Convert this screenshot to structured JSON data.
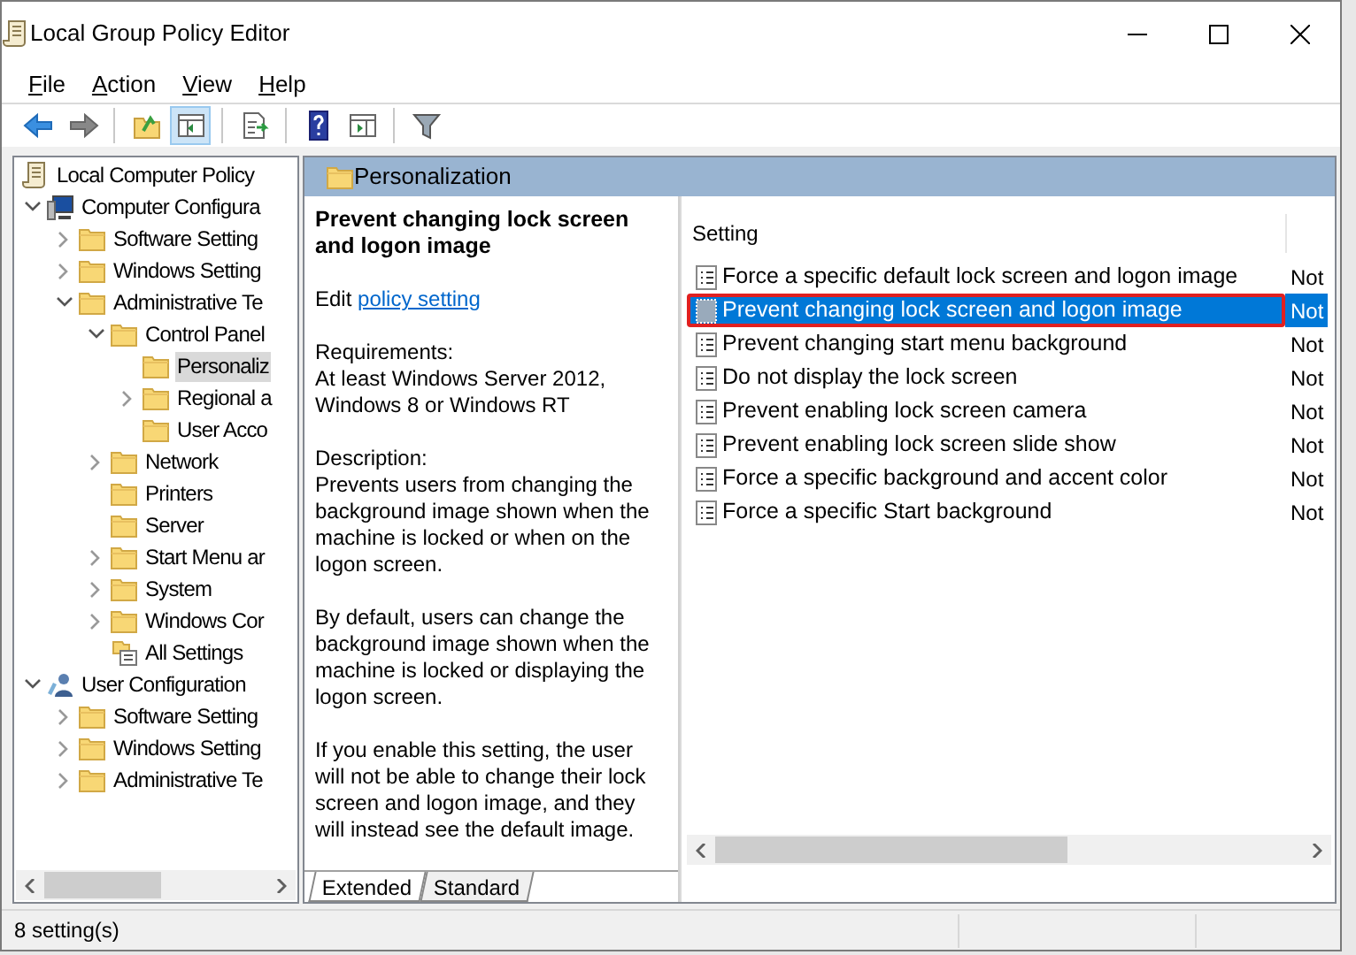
{
  "window": {
    "title": "Local Group Policy Editor"
  },
  "menu": [
    "File",
    "Action",
    "View",
    "Help"
  ],
  "toolbar": [
    {
      "kind": "back",
      "pressed": false
    },
    {
      "kind": "forward",
      "pressed": false
    },
    {
      "kind": "sep"
    },
    {
      "kind": "up",
      "pressed": false
    },
    {
      "kind": "tree-pane",
      "pressed": true
    },
    {
      "kind": "sep"
    },
    {
      "kind": "export",
      "pressed": false
    },
    {
      "kind": "sep"
    },
    {
      "kind": "help",
      "pressed": false
    },
    {
      "kind": "action-pane",
      "pressed": false
    },
    {
      "kind": "sep"
    },
    {
      "kind": "filter",
      "pressed": false
    }
  ],
  "tree": {
    "label": "Local Computer Policy",
    "kind": "policy",
    "children": [
      {
        "label": "Computer Configura",
        "kind": "computer",
        "expanded": true,
        "selected": false,
        "children": [
          {
            "label": "Software Setting",
            "kind": "folder",
            "expanded": false,
            "selected": false
          },
          {
            "label": "Windows Setting",
            "kind": "folder",
            "expanded": false,
            "selected": false
          },
          {
            "label": "Administrative Te",
            "kind": "folder",
            "expanded": true,
            "selected": false,
            "children": [
              {
                "label": "Control Panel",
                "kind": "folder",
                "expanded": true,
                "selected": false,
                "children": [
                  {
                    "label": "Personaliz",
                    "kind": "folder",
                    "selected": true
                  },
                  {
                    "label": "Regional a",
                    "kind": "folder",
                    "expanded": false,
                    "selected": false
                  },
                  {
                    "label": "User Acco",
                    "kind": "folder",
                    "selected": false
                  }
                ]
              },
              {
                "label": "Network",
                "kind": "folder",
                "expanded": false,
                "selected": false
              },
              {
                "label": "Printers",
                "kind": "folder",
                "selected": false
              },
              {
                "label": "Server",
                "kind": "folder",
                "selected": false
              },
              {
                "label": "Start Menu ar",
                "kind": "folder",
                "expanded": false,
                "selected": false
              },
              {
                "label": "System",
                "kind": "folder",
                "expanded": false,
                "selected": false
              },
              {
                "label": "Windows Cor",
                "kind": "folder",
                "expanded": false,
                "selected": false
              },
              {
                "label": "All Settings",
                "kind": "all-settings",
                "selected": false
              }
            ]
          }
        ]
      },
      {
        "label": "User Configuration",
        "kind": "user",
        "expanded": true,
        "selected": false,
        "children": [
          {
            "label": "Software Setting",
            "kind": "folder",
            "expanded": false,
            "selected": false
          },
          {
            "label": "Windows Setting",
            "kind": "folder",
            "expanded": false,
            "selected": false
          },
          {
            "label": "Administrative Te",
            "kind": "folder",
            "expanded": false,
            "selected": false
          }
        ]
      }
    ]
  },
  "header": {
    "title": "Personalization"
  },
  "detail": {
    "title": "Prevent changing lock screen and logon image",
    "edit_prefix": "Edit",
    "edit_link": "policy setting",
    "requirements_label": "Requirements:",
    "requirements": "At least Windows Server 2012, Windows 8 or Windows RT",
    "description_label": "Description:",
    "paragraphs": [
      "Prevents users from changing the background image shown when the machine is locked or when on the logon screen.",
      "By default, users can change the background image shown when the machine is locked or displaying the logon screen.",
      "If you enable this setting, the user will not be able to change their lock screen and logon image, and they will instead see the default image."
    ]
  },
  "settings": {
    "columns": [
      "Setting"
    ],
    "rows": [
      {
        "setting": "Force a specific default lock screen and logon image",
        "column_2": "Not",
        "selected": false,
        "outlined": false
      },
      {
        "setting": "Prevent changing lock screen and logon image",
        "column_2": "Not",
        "selected": true,
        "outlined": true
      },
      {
        "setting": "Prevent changing start menu background",
        "column_2": "Not",
        "selected": false,
        "outlined": false
      },
      {
        "setting": "Do not display the lock screen",
        "column_2": "Not",
        "selected": false,
        "outlined": false
      },
      {
        "setting": "Prevent enabling lock screen camera",
        "column_2": "Not",
        "selected": false,
        "outlined": false
      },
      {
        "setting": "Prevent enabling lock screen slide show",
        "column_2": "Not",
        "selected": false,
        "outlined": false
      },
      {
        "setting": "Force a specific background and accent color",
        "column_2": "Not",
        "selected": false,
        "outlined": false
      },
      {
        "setting": "Force a specific Start background",
        "column_2": "Not",
        "selected": false,
        "outlined": false
      }
    ]
  },
  "tabs": [
    {
      "label": "Extended",
      "selected": true
    },
    {
      "label": "Standard",
      "selected": false
    }
  ],
  "status_bar": {
    "text": "8 setting(s)"
  }
}
